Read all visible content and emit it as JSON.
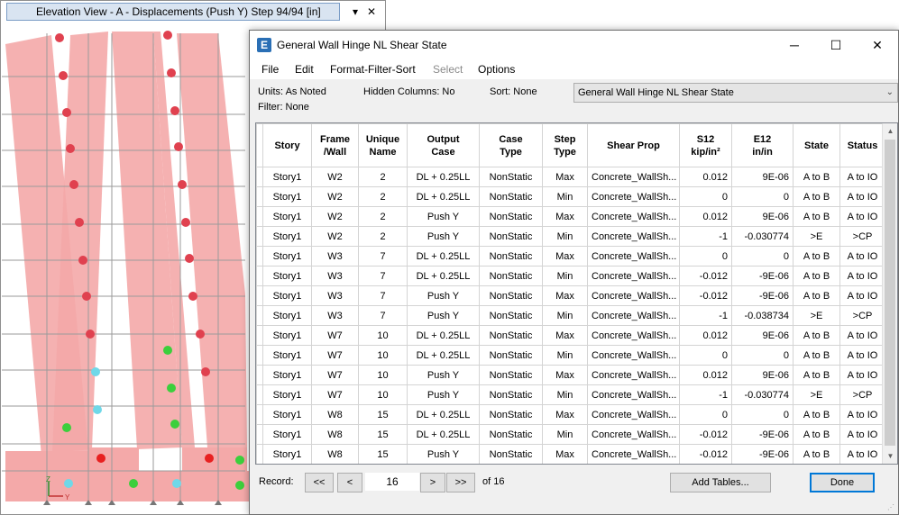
{
  "elevation_window": {
    "title": "Elevation View - A   - Displacements (Push Y)  Step 94/94  [in]",
    "pin": "▾",
    "close": "✕",
    "axis_z": "Z",
    "axis_y": "Y"
  },
  "dialog": {
    "icon": "E",
    "title": "General Wall Hinge NL Shear State",
    "minimize": "─",
    "maximize": "☐",
    "close": "✕",
    "menu": [
      "File",
      "Edit",
      "Format-Filter-Sort",
      "Select",
      "Options"
    ],
    "info": {
      "units": "Units:  As Noted",
      "hidden_columns": "Hidden Columns:  No",
      "sort": "Sort:  None",
      "filter": "Filter:  None"
    },
    "table_select": "General Wall Hinge NL Shear State",
    "columns": [
      {
        "l1": "Story",
        "l2": ""
      },
      {
        "l1": "Frame",
        "l2": "/Wall"
      },
      {
        "l1": "Unique",
        "l2": "Name"
      },
      {
        "l1": "Output",
        "l2": "Case"
      },
      {
        "l1": "Case",
        "l2": "Type"
      },
      {
        "l1": "Step",
        "l2": "Type"
      },
      {
        "l1": "Shear Prop",
        "l2": ""
      },
      {
        "l1": "S12",
        "l2": "kip/in²"
      },
      {
        "l1": "E12",
        "l2": "in/in"
      },
      {
        "l1": "State",
        "l2": ""
      },
      {
        "l1": "Status",
        "l2": ""
      }
    ],
    "rows": [
      [
        "Story1",
        "W2",
        "2",
        "DL + 0.25LL",
        "NonStatic",
        "Max",
        "Concrete_WallSh...",
        "0.012",
        "9E-06",
        "A to B",
        "A to IO"
      ],
      [
        "Story1",
        "W2",
        "2",
        "DL + 0.25LL",
        "NonStatic",
        "Min",
        "Concrete_WallSh...",
        "0",
        "0",
        "A to B",
        "A to IO"
      ],
      [
        "Story1",
        "W2",
        "2",
        "Push Y",
        "NonStatic",
        "Max",
        "Concrete_WallSh...",
        "0.012",
        "9E-06",
        "A to B",
        "A to IO"
      ],
      [
        "Story1",
        "W2",
        "2",
        "Push Y",
        "NonStatic",
        "Min",
        "Concrete_WallSh...",
        "-1",
        "-0.030774",
        ">E",
        ">CP"
      ],
      [
        "Story1",
        "W3",
        "7",
        "DL + 0.25LL",
        "NonStatic",
        "Max",
        "Concrete_WallSh...",
        "0",
        "0",
        "A to B",
        "A to IO"
      ],
      [
        "Story1",
        "W3",
        "7",
        "DL + 0.25LL",
        "NonStatic",
        "Min",
        "Concrete_WallSh...",
        "-0.012",
        "-9E-06",
        "A to B",
        "A to IO"
      ],
      [
        "Story1",
        "W3",
        "7",
        "Push Y",
        "NonStatic",
        "Max",
        "Concrete_WallSh...",
        "-0.012",
        "-9E-06",
        "A to B",
        "A to IO"
      ],
      [
        "Story1",
        "W3",
        "7",
        "Push Y",
        "NonStatic",
        "Min",
        "Concrete_WallSh...",
        "-1",
        "-0.038734",
        ">E",
        ">CP"
      ],
      [
        "Story1",
        "W7",
        "10",
        "DL + 0.25LL",
        "NonStatic",
        "Max",
        "Concrete_WallSh...",
        "0.012",
        "9E-06",
        "A to B",
        "A to IO"
      ],
      [
        "Story1",
        "W7",
        "10",
        "DL + 0.25LL",
        "NonStatic",
        "Min",
        "Concrete_WallSh...",
        "0",
        "0",
        "A to B",
        "A to IO"
      ],
      [
        "Story1",
        "W7",
        "10",
        "Push Y",
        "NonStatic",
        "Max",
        "Concrete_WallSh...",
        "0.012",
        "9E-06",
        "A to B",
        "A to IO"
      ],
      [
        "Story1",
        "W7",
        "10",
        "Push Y",
        "NonStatic",
        "Min",
        "Concrete_WallSh...",
        "-1",
        "-0.030774",
        ">E",
        ">CP"
      ],
      [
        "Story1",
        "W8",
        "15",
        "DL + 0.25LL",
        "NonStatic",
        "Max",
        "Concrete_WallSh...",
        "0",
        "0",
        "A to B",
        "A to IO"
      ],
      [
        "Story1",
        "W8",
        "15",
        "DL + 0.25LL",
        "NonStatic",
        "Min",
        "Concrete_WallSh...",
        "-0.012",
        "-9E-06",
        "A to B",
        "A to IO"
      ],
      [
        "Story1",
        "W8",
        "15",
        "Push Y",
        "NonStatic",
        "Max",
        "Concrete_WallSh...",
        "-0.012",
        "-9E-06",
        "A to B",
        "A to IO"
      ]
    ],
    "record_label": "Record:",
    "nav": {
      "first": "<<",
      "prev": "<",
      "next": ">",
      "last": ">>"
    },
    "record_value": "16",
    "record_total": "of 16",
    "add_tables": "Add Tables...",
    "done": "Done"
  }
}
